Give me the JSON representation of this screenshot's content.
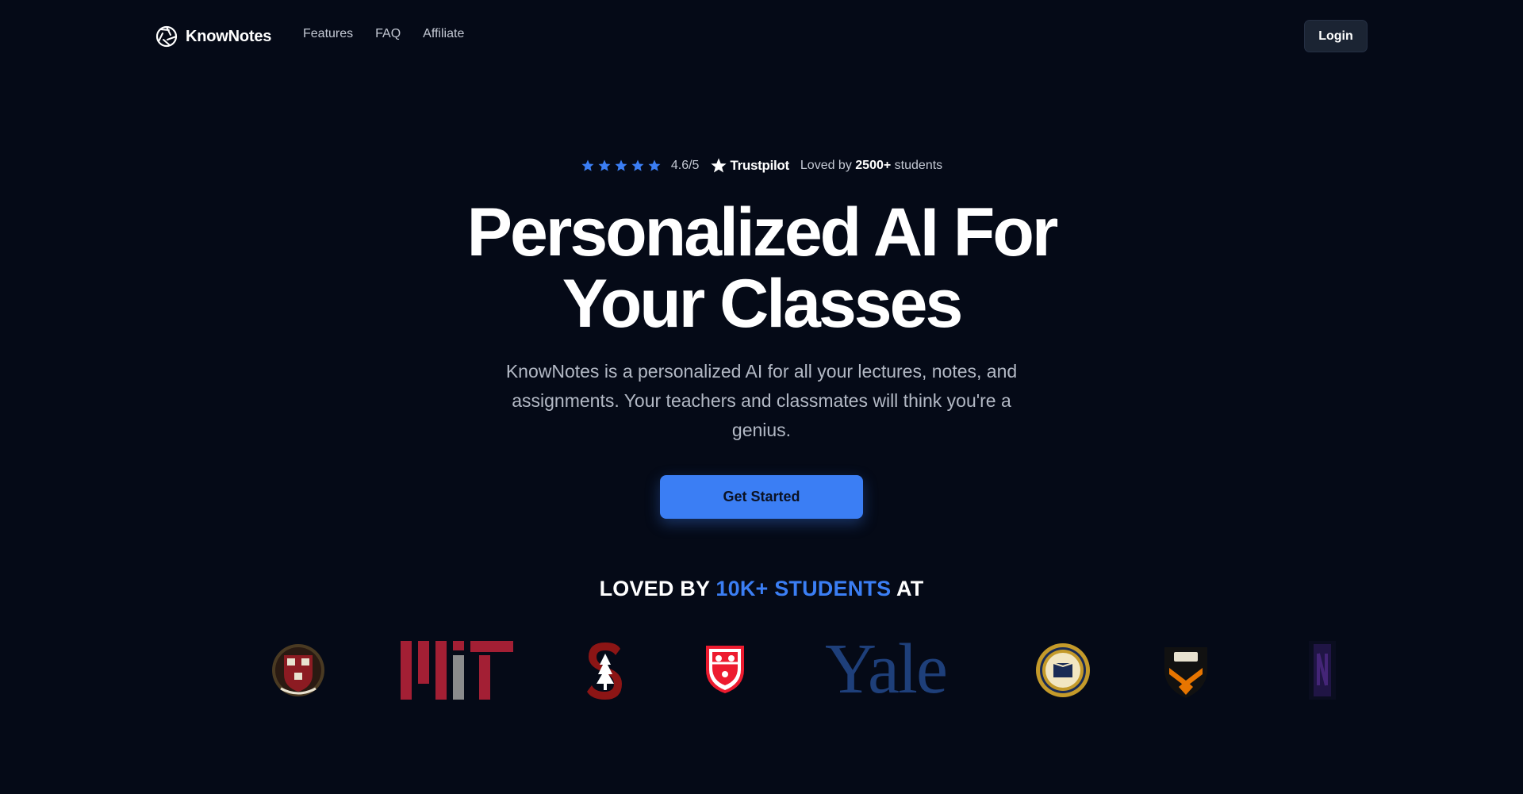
{
  "nav": {
    "brand": "KnowNotes",
    "links": [
      "Features",
      "FAQ",
      "Affiliate"
    ],
    "login": "Login"
  },
  "rating": {
    "stars": 5,
    "score": "4.6/5",
    "platform": "Trustpilot",
    "loved_prefix": "Loved by",
    "loved_count": "2500+",
    "loved_suffix": "students"
  },
  "hero": {
    "title_line1": "Personalized AI For",
    "title_line2": "Your Classes",
    "subtitle": "KnowNotes is a personalized AI for all your lectures, notes, and assignments. Your teachers and classmates will think you're a genius.",
    "cta": "Get Started"
  },
  "social_proof": {
    "prefix": "LOVED BY",
    "highlight": "10K+ STUDENTS",
    "suffix": "AT",
    "logos": [
      "Harvard crest",
      "MIT",
      "Stanford",
      "McGill crest",
      "Yale",
      "UC Berkeley seal",
      "Princeton shield",
      "Northwestern"
    ]
  },
  "yale_logo_text": "Yale",
  "colors": {
    "background": "#050a17",
    "accent": "#3b7ef4",
    "login_bg": "#1b2433",
    "muted_text": "#b3b9c5"
  }
}
